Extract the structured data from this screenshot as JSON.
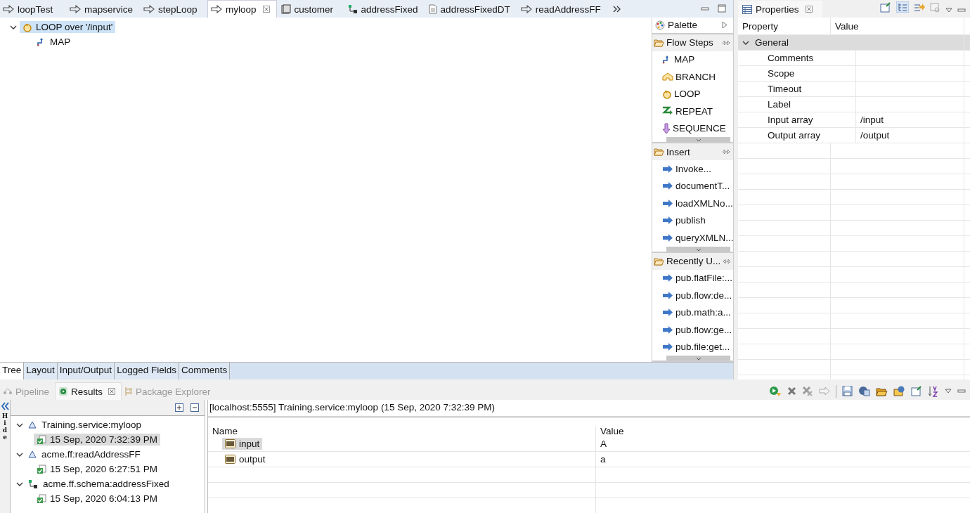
{
  "editor_tabs": [
    {
      "label": "loopTest",
      "kind": "flow",
      "selected": false,
      "closable": false
    },
    {
      "label": "mapservice",
      "kind": "flow",
      "selected": false,
      "closable": false
    },
    {
      "label": "stepLoop",
      "kind": "flow",
      "selected": false,
      "closable": false
    },
    {
      "label": "myloop",
      "kind": "flow",
      "selected": true,
      "closable": true
    },
    {
      "label": "customer",
      "kind": "document",
      "selected": false,
      "closable": false
    },
    {
      "label": "addressFixed",
      "kind": "schema",
      "selected": false,
      "closable": false
    },
    {
      "label": "addressFixedDT",
      "kind": "page",
      "selected": false,
      "closable": false
    },
    {
      "label": "readAddressFF",
      "kind": "flow",
      "selected": false,
      "closable": false
    }
  ],
  "flow_tree": [
    {
      "label": "LOOP over '/input'",
      "kind": "loop",
      "selected": true,
      "expanded": true,
      "children": [
        {
          "label": "MAP",
          "kind": "map",
          "selected": false
        }
      ]
    }
  ],
  "palette": {
    "title": "Palette",
    "drawers": [
      {
        "title": "Flow Steps",
        "items": [
          {
            "label": "MAP",
            "kind": "map"
          },
          {
            "label": "BRANCH",
            "kind": "branch"
          },
          {
            "label": "LOOP",
            "kind": "loop"
          },
          {
            "label": "REPEAT",
            "kind": "repeat"
          },
          {
            "label": "SEQUENCE",
            "kind": "sequence"
          }
        ]
      },
      {
        "title": "Insert",
        "items": [
          {
            "label": "Invoke...",
            "kind": "invoke"
          },
          {
            "label": "documentT...",
            "kind": "invoke"
          },
          {
            "label": "loadXMLNo...",
            "kind": "invoke"
          },
          {
            "label": "publish",
            "kind": "invoke"
          },
          {
            "label": "queryXMLN...",
            "kind": "invoke"
          }
        ]
      },
      {
        "title": "Recently U...",
        "items": [
          {
            "label": "pub.flatFile:...",
            "kind": "invoke"
          },
          {
            "label": "pub.flow:de...",
            "kind": "invoke"
          },
          {
            "label": "pub.math:a...",
            "kind": "invoke"
          },
          {
            "label": "pub.flow:ge...",
            "kind": "invoke"
          },
          {
            "label": "pub.file:get...",
            "kind": "invoke"
          }
        ]
      }
    ]
  },
  "editor_bottom_tabs": [
    {
      "label": "Tree",
      "selected": true
    },
    {
      "label": "Layout",
      "selected": false
    },
    {
      "label": "Input/Output",
      "selected": false
    },
    {
      "label": "Logged Fields",
      "selected": false
    },
    {
      "label": "Comments",
      "selected": false
    }
  ],
  "properties": {
    "title": "Properties",
    "columns": [
      "Property",
      "Value"
    ],
    "group": {
      "label": "General",
      "expanded": true
    },
    "rows": [
      {
        "property": "Comments",
        "value": ""
      },
      {
        "property": "Scope",
        "value": ""
      },
      {
        "property": "Timeout",
        "value": ""
      },
      {
        "property": "Label",
        "value": ""
      },
      {
        "property": "Input array",
        "value": "/input"
      },
      {
        "property": "Output array",
        "value": "/output"
      }
    ]
  },
  "bottom_tabs": [
    {
      "label": "Pipeline",
      "kind": "pipeline",
      "selected": false,
      "disabled": true,
      "closable": false
    },
    {
      "label": "Results",
      "kind": "results",
      "selected": true,
      "disabled": false,
      "closable": true
    },
    {
      "label": "Package Explorer",
      "kind": "package",
      "selected": false,
      "disabled": true,
      "closable": false
    }
  ],
  "side_strip": {
    "label": "Hide"
  },
  "results_tree": [
    {
      "label": "Training.service:myloop",
      "kind": "service",
      "expanded": true,
      "children": [
        {
          "label": "15 Sep, 2020 7:32:39 PM",
          "selected": true
        }
      ]
    },
    {
      "label": "acme.ff:readAddressFF",
      "kind": "service",
      "expanded": true,
      "children": [
        {
          "label": "15 Sep, 2020 6:27:51 PM",
          "selected": false
        }
      ]
    },
    {
      "label": "acme.ff.schema:addressFixed",
      "kind": "schema",
      "expanded": true,
      "children": [
        {
          "label": "15 Sep, 2020 6:04:13 PM",
          "selected": false
        }
      ]
    }
  ],
  "results_header": "[localhost:5555] Training.service:myloop (15 Sep, 2020 7:32:39 PM)",
  "results_table": {
    "columns": [
      "Name",
      "Value"
    ],
    "rows": [
      {
        "name": "input",
        "value": "A",
        "selected": true
      },
      {
        "name": "output",
        "value": "a",
        "selected": false
      }
    ]
  }
}
